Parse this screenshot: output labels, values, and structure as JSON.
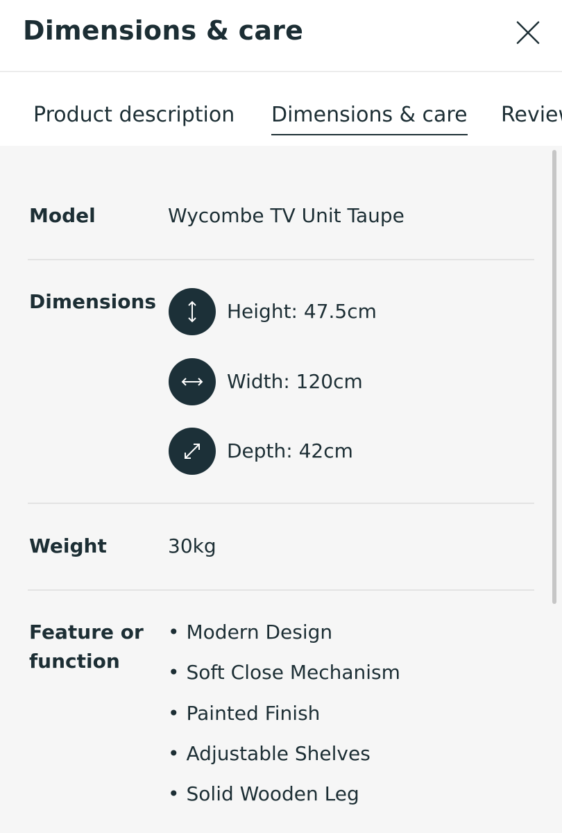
{
  "header": {
    "title": "Dimensions & care",
    "close_icon": "close-icon"
  },
  "tabs": [
    {
      "label": "Product description",
      "active": false
    },
    {
      "label": "Dimensions & care",
      "active": true
    },
    {
      "label": "Reviews",
      "active": false
    }
  ],
  "specs": {
    "model": {
      "label": "Model",
      "value": "Wycombe TV Unit Taupe"
    },
    "dimensions": {
      "label": "Dimensions",
      "items": [
        {
          "icon": "vertical-arrow-icon",
          "text": "Height: 47.5cm"
        },
        {
          "icon": "horizontal-arrow-icon",
          "text": "Width: 120cm"
        },
        {
          "icon": "diagonal-arrow-icon",
          "text": "Depth: 42cm"
        }
      ]
    },
    "weight": {
      "label": "Weight",
      "value": "30kg"
    },
    "features": {
      "label_line1": "Feature or",
      "label_line2": "function",
      "items": [
        "Modern Design",
        "Soft Close Mechanism",
        "Painted Finish",
        "Adjustable Shelves",
        "Solid Wooden Leg"
      ]
    }
  },
  "colors": {
    "primary_dark": "#1c3038",
    "content_bg": "#f6f6f6",
    "divider": "#e3e3e3"
  }
}
